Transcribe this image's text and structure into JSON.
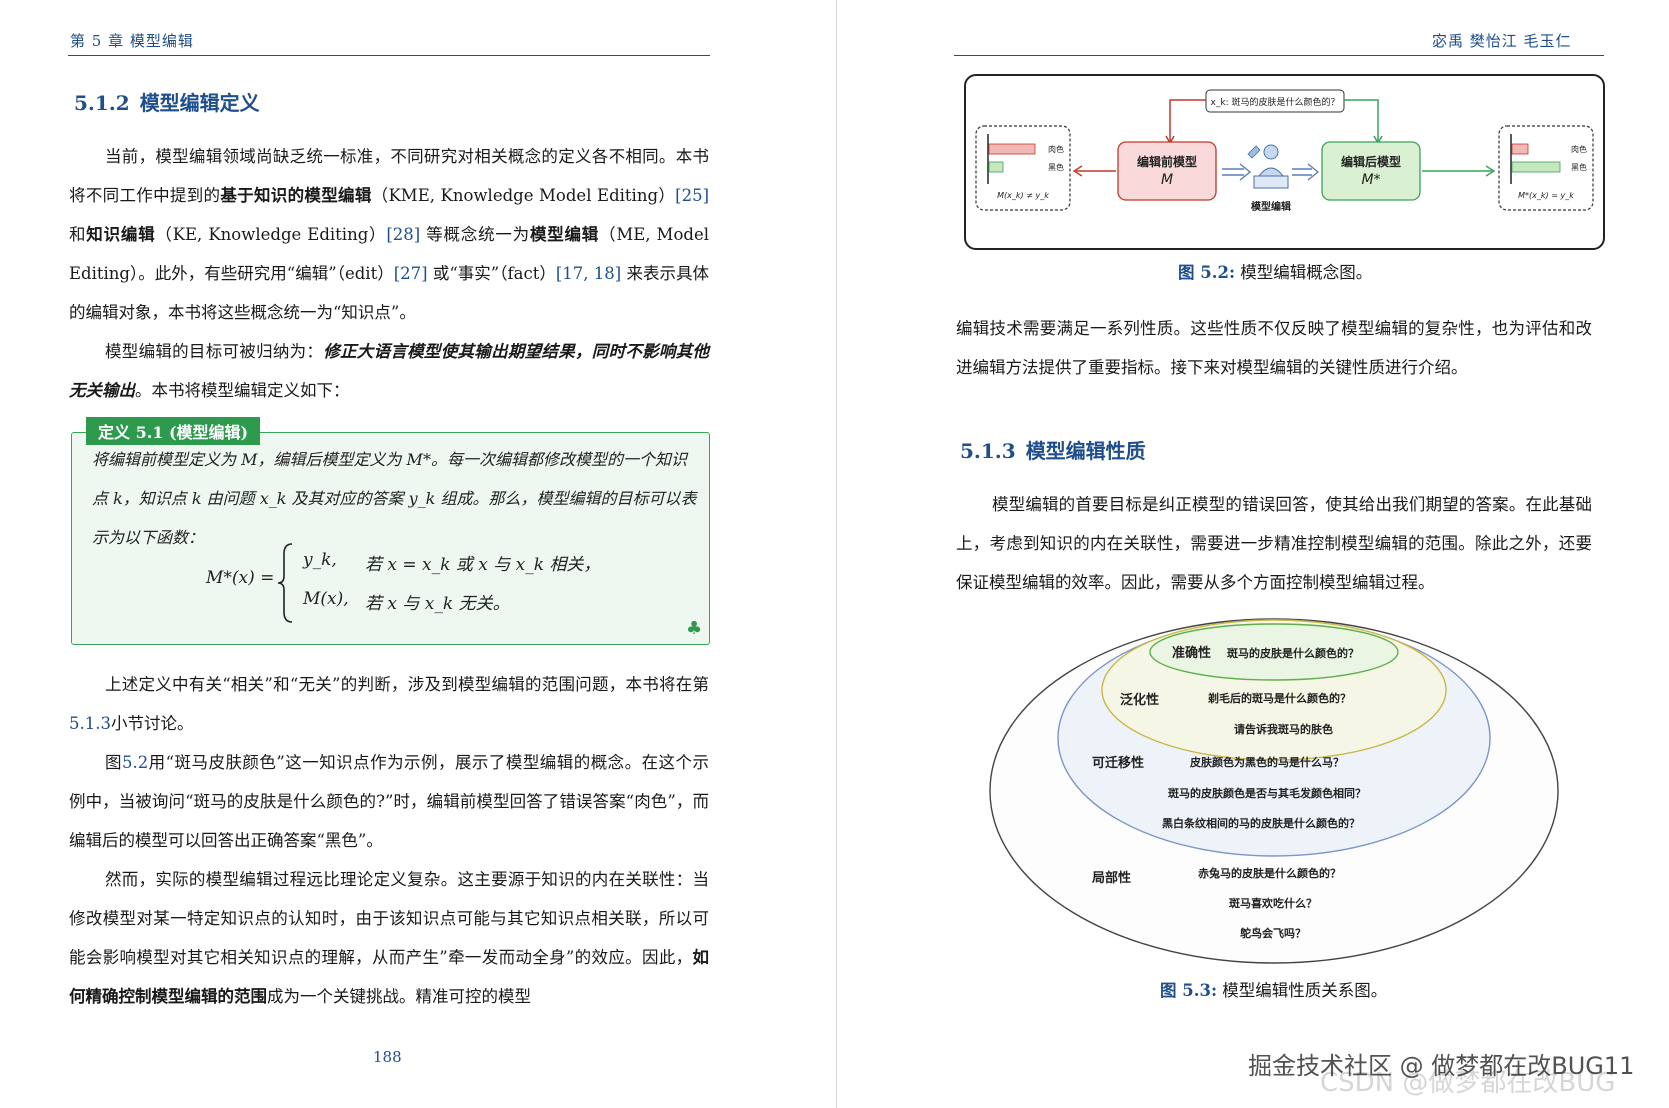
{
  "left_page": {
    "running_head": "第 5 章  模型编辑",
    "section": {
      "number": "5.1.2",
      "title": "模型编辑定义"
    },
    "para1": {
      "t1": "当前，模型编辑领域尚缺乏统一标准，不同研究对相关概念的定义各不相同。本书将不同工作中提到的",
      "b1": "基于知识的模型编辑",
      "t2": "（KME, Knowledge Model Editing）",
      "c1": "[25]",
      "t3": " 和",
      "b2": "知识编辑",
      "t4": "（KE, Knowledge Editing）",
      "c2": "[28]",
      "t5": " 等概念统一为",
      "b3": "模型编辑",
      "t6": "（ME, Model Editing）。此外，有些研究用“编辑”（edit）",
      "c3": "[27]",
      "t7": " 或“事实”（fact）",
      "c4": "[17, 18]",
      "t8": " 来表示具体的编辑对象，本书将这些概念统一为“知识点”。"
    },
    "para2": {
      "t1": "模型编辑的目标可被归纳为：",
      "b1": "修正大语言模型使其输出期望结果，同时不影响其他无关输出",
      "t2": "。本书将模型编辑定义如下："
    },
    "definition": {
      "tag": "定义 5.1 (模型编辑)",
      "text": "将编辑前模型定义为 M，编辑后模型定义为 M*。每一次编辑都修改模型的一个知识点 k，知识点 k 由问题 x_k 及其对应的答案 y_k 组成。那么，模型编辑的目标可以表示为以下函数：",
      "lhs": "M*(x) =",
      "case1_val": "y_k,",
      "case1_cond": "若 x = x_k 或 x 与 x_k 相关，",
      "case2_val": "M(x),",
      "case2_cond": "若 x 与 x_k 无关。"
    },
    "para3": {
      "t1": "上述定义中有关“相关”和“无关”的判断，涉及到模型编辑的范围问题，本书将在第 ",
      "c1": "5.1.3",
      "t2": "小节讨论。"
    },
    "para4": {
      "t1": "图",
      "c1": "5.2",
      "t2": "用“斑马皮肤颜色”这一知识点作为示例，展示了模型编辑的概念。在这个示例中，当被询问“斑马的皮肤是什么颜色的?”时，编辑前模型回答了错误答案“肉色”，而编辑后的模型可以回答出正确答案“黑色”。"
    },
    "para5": {
      "t1": "然而，实际的模型编辑过程远比理论定义复杂。这主要源于知识的内在关联性：当修改模型对某一特定知识点的认知时，由于该知识点可能与其它知识点相关联，所以可能会影响模型对其它相关知识点的理解，从而产生”牵一发而动全身”的效应。因此，",
      "b1": "如何精确控制模型编辑的范围",
      "t2": "成为一个关键挑战。精准可控的模型"
    },
    "page_number": "188"
  },
  "right_page": {
    "running_head": "宓禹 樊怡江 毛玉仁",
    "figure52": {
      "query": "x_k: 斑马的皮肤是什么颜色的？",
      "before_model_title": "编辑前模型",
      "before_model_symbol": "M",
      "after_model_title": "编辑后模型",
      "after_model_symbol": "M*",
      "editing_label": "模型编辑",
      "label_rouse": "肉色",
      "label_black": "黑色",
      "left_eq": "M(x_k) ≠ y_k",
      "right_eq": "M*(x_k) = y_k",
      "caption_label": "图 5.2:",
      "caption_text": " 模型编辑概念图。"
    },
    "para1": "编辑技术需要满足一系列性质。这些性质不仅反映了模型编辑的复杂性，也为评估和改进编辑方法提供了重要指标。接下来对模型编辑的关键性质进行介绍。",
    "section": {
      "number": "5.1.3",
      "title": "模型编辑性质"
    },
    "para2": "模型编辑的首要目标是纠正模型的错误回答，使其给出我们期望的答案。在此基础上，考虑到知识的内在关联性，需要进一步精准控制模型编辑的范围。除此之外，还要保证模型编辑的效率。因此，需要从多个方面控制模型编辑过程。",
    "figure53": {
      "accuracy_label": "准确性",
      "accuracy_q": "斑马的皮肤是什么颜色的？",
      "generalization_label": "泛化性",
      "gen_q1": "剃毛后的斑马是什么颜色的？",
      "gen_q2": "请告诉我斑马的肤色",
      "portability_label": "可迁移性",
      "port_q1": "皮肤颜色为黑色的马是什么马？",
      "port_q2": "斑马的皮肤颜色是否与其毛发颜色相同？",
      "port_q3": "黑白条纹相间的马的皮肤是什么颜色的？",
      "locality_label": "局部性",
      "loc_q1": "赤兔马的皮肤是什么颜色的？",
      "loc_q2": "斑马喜欢吃什么？",
      "loc_q3": "鸵鸟会飞吗？",
      "caption_label": "图 5.3:",
      "caption_text": " 模型编辑性质关系图。"
    },
    "watermark": "掘金技术社区 @ 做梦都在改BUG11",
    "watermark2": "CSDN @做梦都在改BUG"
  },
  "colors": {
    "accent": "#1f4e8c",
    "def_green": "#2e9a4e",
    "def_bg": "#eef8f0"
  }
}
